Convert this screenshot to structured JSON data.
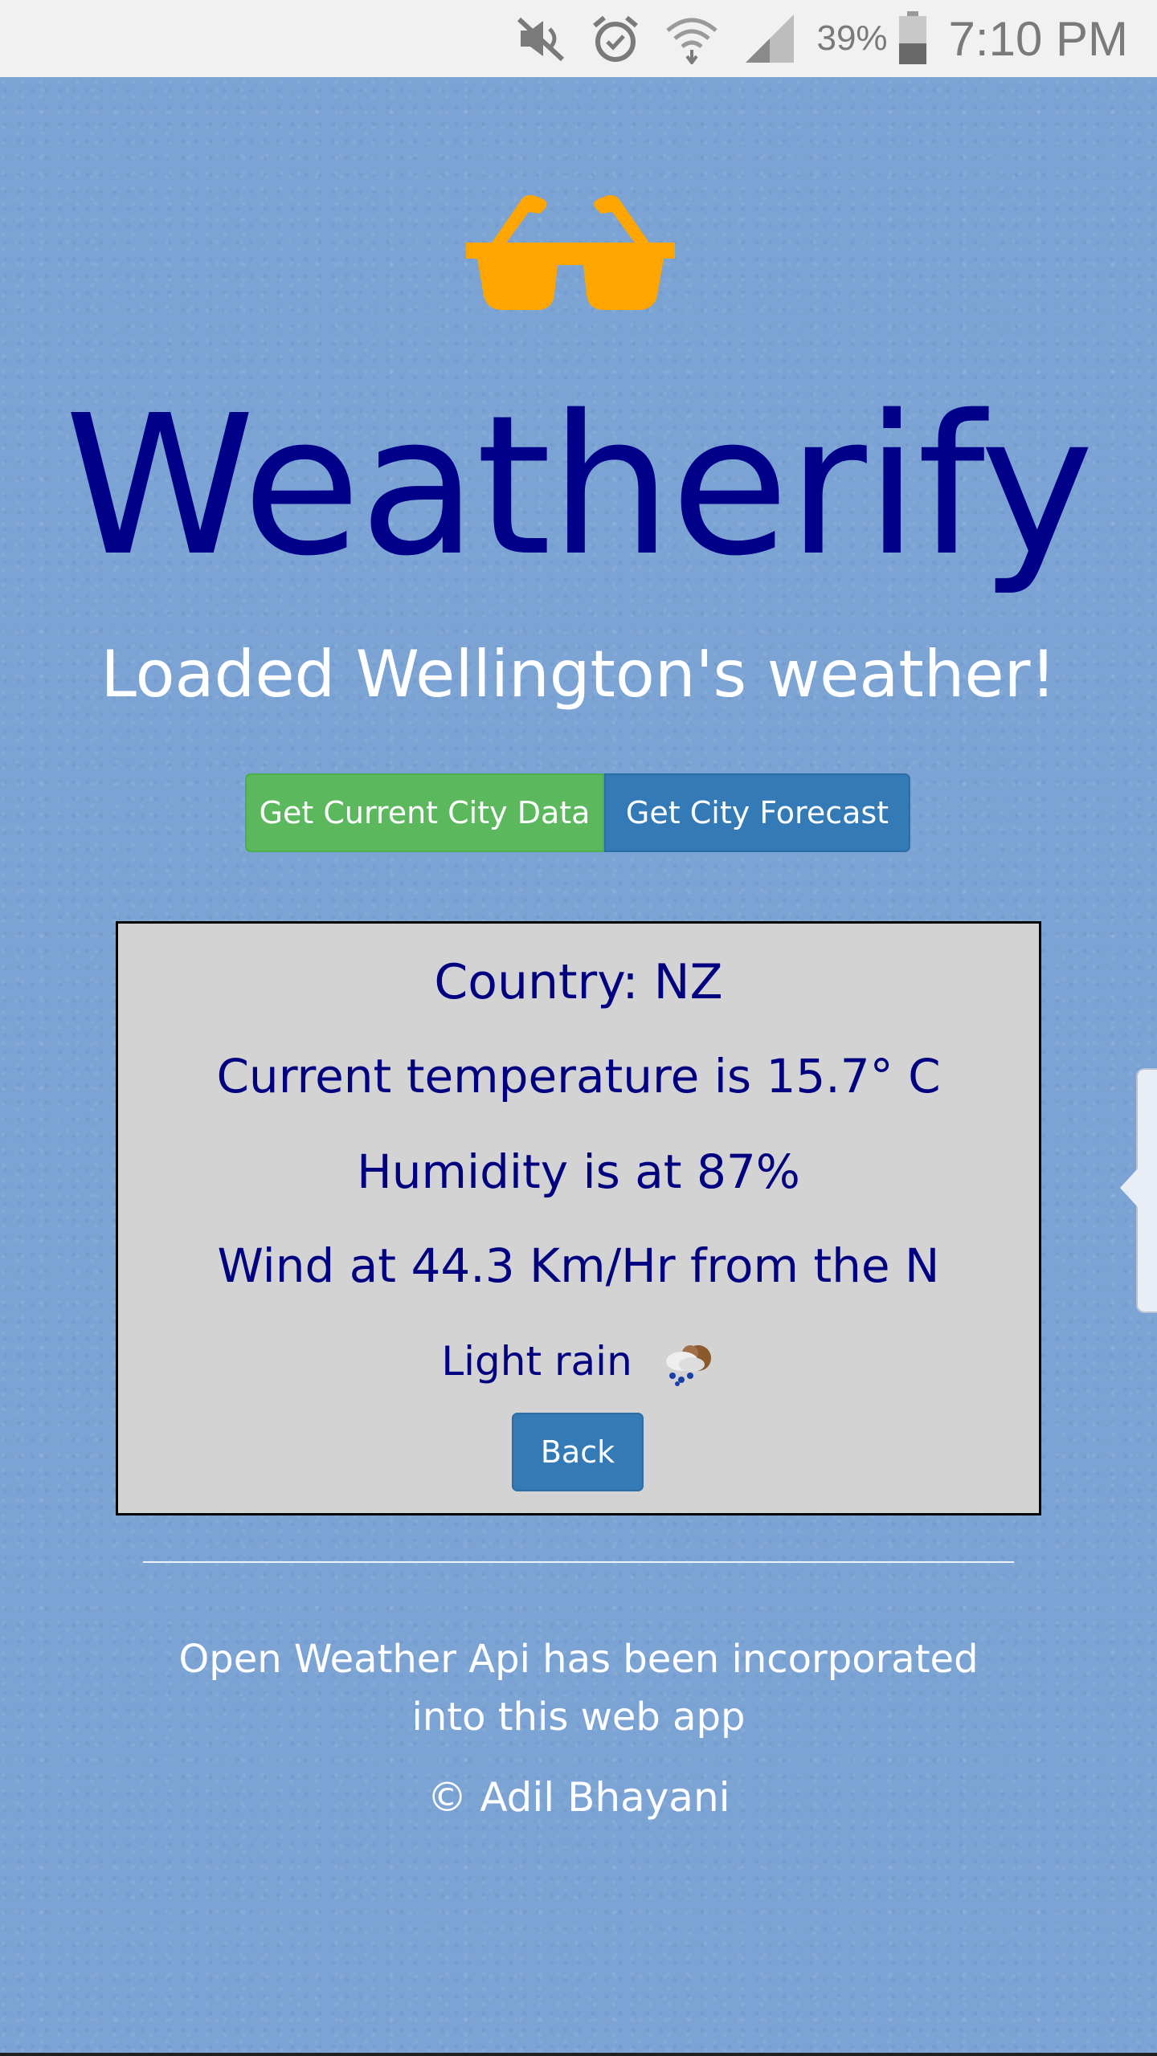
{
  "status_bar": {
    "icons": [
      "mute-icon",
      "alarm-icon",
      "wifi-icon",
      "signal-icon",
      "battery-icon"
    ],
    "battery": "39%",
    "time": "7:10 PM"
  },
  "app": {
    "logo_icon": "sunglasses-icon",
    "logo_color": "#ffa500",
    "title": "Weatherify",
    "title_color": "#000088",
    "status_message": "Loaded Wellington's weather!"
  },
  "buttons": {
    "current_city": "Get Current City Data",
    "forecast": "Get City Forecast",
    "back": "Back"
  },
  "weather": {
    "country": "Country: NZ",
    "temperature": "Current temperature is 15.7° C",
    "humidity": "Humidity is at 87%",
    "wind": "Wind at 44.3 Km/Hr from the N",
    "condition": "Light rain",
    "condition_icon": "rain-cloud-icon"
  },
  "footer": {
    "api_note": "Open Weather Api has been incorporated into this web app",
    "copyright": "© Adil Bhayani"
  },
  "colors": {
    "background": "#7ba3d4",
    "success_button": "#5cb85c",
    "primary_button": "#337ab7",
    "panel": "#d3d3d3",
    "panel_text": "#000080"
  }
}
